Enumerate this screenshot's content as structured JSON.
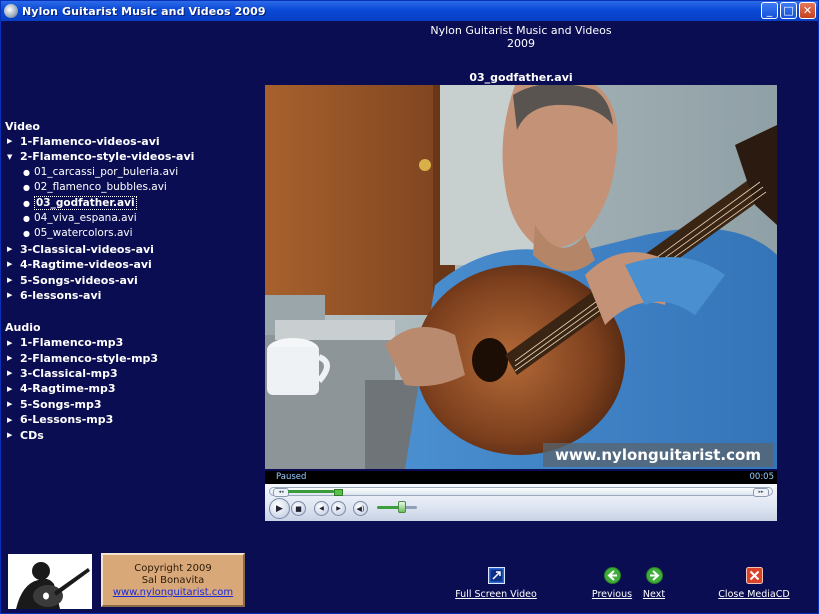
{
  "window": {
    "title": "Nylon Guitarist Music and Videos 2009",
    "buttons": {
      "minimize": "_",
      "maximize": "□",
      "close": "✕"
    }
  },
  "header": {
    "title_line1": "Nylon Guitarist Music and Videos",
    "title_line2": "2009",
    "current_file": "03_godfather.avi"
  },
  "tree": {
    "video": {
      "heading": "Video",
      "folders": [
        {
          "label": "1-Flamenco-videos-avi",
          "expanded": false
        },
        {
          "label": "2-Flamenco-style-videos-avi",
          "expanded": true,
          "files": [
            "01_carcassi_por_buleria.avi",
            "02_flamenco_bubbles.avi",
            "03_godfather.avi",
            "04_viva_espana.avi",
            "05_watercolors.avi"
          ],
          "selected_index": 2
        },
        {
          "label": "3-Classical-videos-avi",
          "expanded": false
        },
        {
          "label": "4-Ragtime-videos-avi",
          "expanded": false
        },
        {
          "label": "5-Songs-videos-avi",
          "expanded": false
        },
        {
          "label": "6-lessons-avi",
          "expanded": false
        }
      ]
    },
    "audio": {
      "heading": "Audio",
      "folders": [
        "1-Flamenco-mp3",
        "2-Flamenco-style-mp3",
        "3-Classical-mp3",
        "4-Ragtime-mp3",
        "5-Songs-mp3",
        "6-Lessons-mp3",
        "CDs"
      ]
    }
  },
  "player": {
    "watermark": "www.nylonguitarist.com",
    "status": "Paused",
    "time": "00:05",
    "seek_fraction": 0.1,
    "volume_fraction": 0.6
  },
  "copyright": {
    "line1": "Copyright 2009",
    "line2": "Sal Bonavita",
    "link": "www.nylonguitarist.com"
  },
  "actions": {
    "fullscreen": "Full Screen Video",
    "previous": "Previous",
    "next": "Next",
    "close": "Close MediaCD"
  },
  "colors": {
    "background": "#0b0d52",
    "accent_green": "#3fae3a",
    "close_red": "#d8432a"
  }
}
